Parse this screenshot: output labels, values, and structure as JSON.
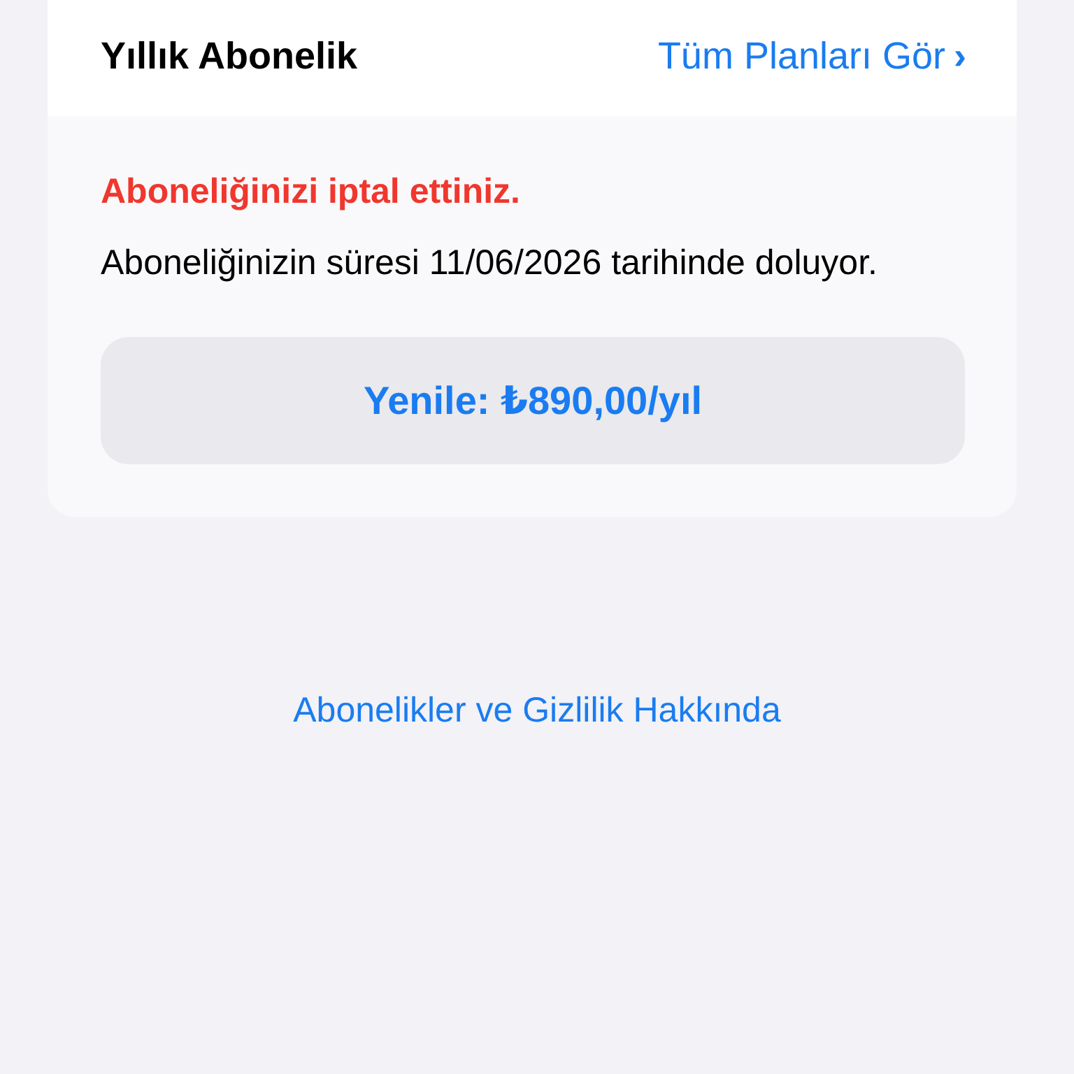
{
  "plan_row": {
    "label": "Yıllık Abonelik",
    "link": "Tüm Planları Gör",
    "chevron": "›"
  },
  "notice": {
    "title": "Aboneliğinizi iptal ettiniz.",
    "body": "Aboneliğinizin süresi 11/06/2026 tarihinde doluyor."
  },
  "renew_button": {
    "label": "Yenile: ₺890,00/yıl"
  },
  "footer_link": "Abonelikler ve Gizlilik Hakkında"
}
